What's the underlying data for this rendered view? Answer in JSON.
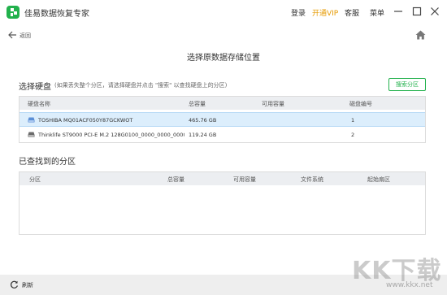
{
  "app": {
    "title": "佳易数据恢复专家"
  },
  "topmenu": {
    "login": "登录",
    "vip": "开通VIP",
    "service": "客服",
    "menu": "菜单"
  },
  "nav": {
    "back": "返回"
  },
  "page": {
    "title": "选择原数据存储位置"
  },
  "disks": {
    "title": "选择硬盘",
    "hint": "(如果丢失整个分区，请选择硬盘并点击 \"搜索\" 以查找硬盘上的分区)",
    "search_button": "搜索分区",
    "columns": [
      "硬盘名称",
      "总容量",
      "可用容量",
      "磁盘编号"
    ],
    "rows": [
      {
        "name": "TOSHIBA MQ01ACF050Y87GCKWOT",
        "total": "465.76 GB",
        "free": "",
        "number": "1",
        "selected": true
      },
      {
        "name": "Thinklife ST9000 PCI-E M.2 128G0100_0000_0000_0000.",
        "total": "119.24 GB",
        "free": "",
        "number": "2",
        "selected": false
      }
    ]
  },
  "partitions": {
    "title": "已查找到的分区",
    "columns": [
      "分区",
      "总容量",
      "可用容量",
      "文件系统",
      "起始扇区"
    ]
  },
  "status": {
    "refresh": "刷新"
  },
  "watermark": {
    "logo_text": "KK下载",
    "url": "www.kkx.net"
  },
  "colors": {
    "accent": "#22b14c",
    "vip": "#e69a00",
    "selected_row": "#dceefc"
  }
}
